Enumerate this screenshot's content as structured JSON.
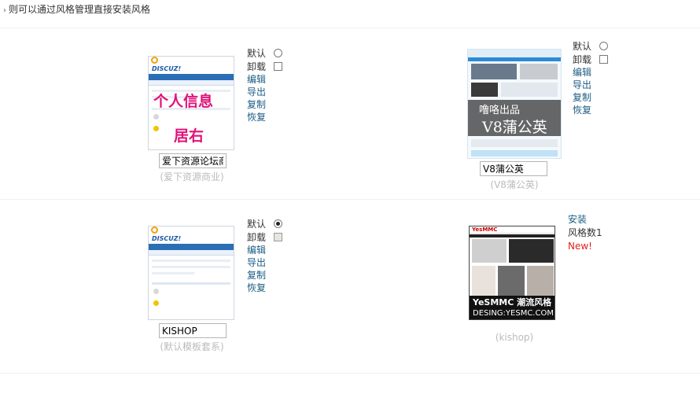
{
  "tip": {
    "text": "则可以通过风格管理直接安装风格"
  },
  "styles": [
    {
      "input_value": "爱下资源论坛商",
      "subtitle": "(爱下资源商业)",
      "thumb_overlay": [
        "个人信息",
        "居右"
      ],
      "options": {
        "default_label": "默认",
        "uninstall_label": "卸载",
        "default_checked": false,
        "uninstall_disabled": false
      },
      "actions": [
        "编辑",
        "导出",
        "复制",
        "恢复"
      ]
    },
    {
      "input_value": "V8蒲公英",
      "subtitle": "(V8蒲公英)",
      "thumb_overlay": [
        "噜咯出品",
        "V8蒲公英"
      ],
      "options": {
        "default_label": "默认",
        "uninstall_label": "卸载",
        "default_checked": false,
        "uninstall_disabled": false
      },
      "actions": [
        "编辑",
        "导出",
        "复制",
        "恢复"
      ]
    },
    {
      "input_value": "KISHOP",
      "subtitle": "(默认模板套系)",
      "options": {
        "default_label": "默认",
        "uninstall_label": "卸载",
        "default_checked": true,
        "uninstall_disabled": true
      },
      "actions": [
        "编辑",
        "导出",
        "复制",
        "恢复"
      ]
    },
    {
      "subtitle": "(kishop)",
      "thumb_overlay": [
        "YeSMMC 潮流风格",
        "DESING:YESMC.COM"
      ],
      "install_label": "安装",
      "style_count": "风格数1",
      "new_badge": "New!"
    }
  ],
  "colors": {
    "link": "#1c5c84",
    "new": "#e02020",
    "overlay_pink": "#e0127a",
    "muted": "#bbbbbb"
  }
}
